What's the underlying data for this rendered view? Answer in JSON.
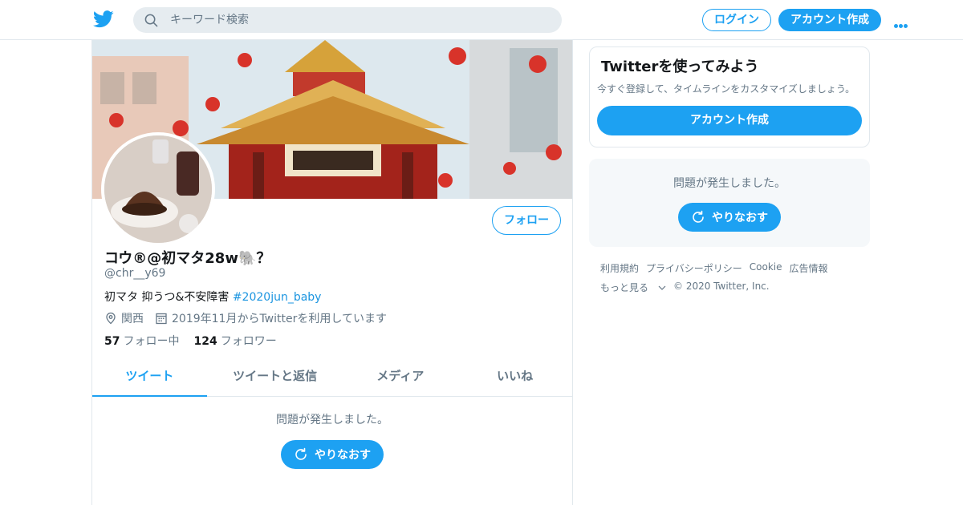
{
  "header": {
    "search_placeholder": "キーワード検索",
    "login_label": "ログイン",
    "signup_label": "アカウント作成"
  },
  "profile": {
    "follow_label": "フォロー",
    "name": "コウ®@初マタ28w🐘？",
    "handle": "@chr__y69",
    "bio_text": "初マタ 抑うつ&不安障害 ",
    "bio_hashtag": "#2020jun_baby",
    "location": "関西",
    "joined": "2019年11月からTwitterを利用しています",
    "following_count": "57",
    "following_label": "フォロー中",
    "followers_count": "124",
    "followers_label": "フォロワー"
  },
  "tabs": [
    {
      "label": "ツイート",
      "active": true
    },
    {
      "label": "ツイートと返信",
      "active": false
    },
    {
      "label": "メディア",
      "active": false
    },
    {
      "label": "いいね",
      "active": false
    }
  ],
  "timeline": {
    "error_message": "問題が発生しました。",
    "retry_label": "やりなおす"
  },
  "signup_card": {
    "title": "Twitterを使ってみよう",
    "subtitle": "今すぐ登録して、タイムラインをカスタマイズしましょう。",
    "button_label": "アカウント作成"
  },
  "side_error": {
    "message": "問題が発生しました。",
    "retry_label": "やりなおす"
  },
  "footer": {
    "links": [
      "利用規約",
      "プライバシーポリシー",
      "Cookie",
      "広告情報"
    ],
    "more_label": "もっと見る",
    "copyright": "© 2020 Twitter, Inc."
  },
  "colors": {
    "accent": "#1da1f2",
    "text_secondary": "#657786",
    "border": "#e1e8ed"
  }
}
